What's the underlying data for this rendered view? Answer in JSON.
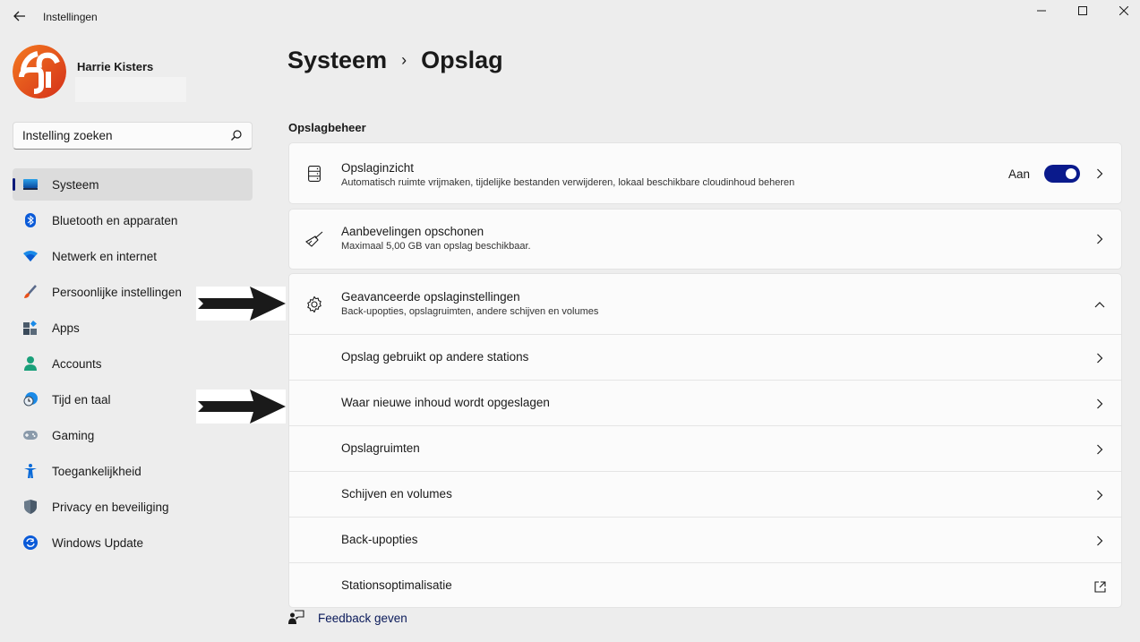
{
  "window": {
    "title": "Instellingen",
    "back_icon": "arrow-left-icon",
    "controls": [
      "minimize-icon",
      "maximize-icon",
      "close-icon"
    ]
  },
  "profile": {
    "name": "Harrie Kisters",
    "avatar_colors": [
      "#e84a1e",
      "#f47a20",
      "#d4301a"
    ]
  },
  "search": {
    "placeholder": "Instelling zoeken",
    "value": ""
  },
  "sidebar": {
    "items": [
      {
        "label": "Systeem",
        "icon": "monitor-icon",
        "active": true
      },
      {
        "label": "Bluetooth en apparaten",
        "icon": "bluetooth-icon",
        "active": false
      },
      {
        "label": "Netwerk en internet",
        "icon": "wifi-icon",
        "active": false
      },
      {
        "label": "Persoonlijke instellingen",
        "icon": "paintbrush-icon",
        "active": false
      },
      {
        "label": "Apps",
        "icon": "apps-icon",
        "active": false
      },
      {
        "label": "Accounts",
        "icon": "person-icon",
        "active": false
      },
      {
        "label": "Tijd en taal",
        "icon": "clock-globe-icon",
        "active": false
      },
      {
        "label": "Gaming",
        "icon": "gamepad-icon",
        "active": false
      },
      {
        "label": "Toegankelijkheid",
        "icon": "accessibility-icon",
        "active": false
      },
      {
        "label": "Privacy en beveiliging",
        "icon": "shield-icon",
        "active": false
      },
      {
        "label": "Windows Update",
        "icon": "update-icon",
        "active": false
      }
    ]
  },
  "breadcrumb": {
    "parent": "Systeem",
    "separator": "›",
    "current": "Opslag"
  },
  "section": {
    "title": "Opslagbeheer"
  },
  "cards": {
    "storage_sense": {
      "title": "Opslaginzicht",
      "subtitle": "Automatisch ruimte vrijmaken, tijdelijke bestanden verwijderen, lokaal beschikbare cloudinhoud beheren",
      "toggle_label": "Aan",
      "toggle_on": true,
      "icon": "storage-drive-icon"
    },
    "cleanup": {
      "title": "Aanbevelingen opschonen",
      "subtitle": "Maximaal 5,00 GB van opslag beschikbaar.",
      "icon": "broom-icon"
    },
    "advanced": {
      "title": "Geavanceerde opslaginstellingen",
      "subtitle": "Back-upopties, opslagruimten, andere schijven en volumes",
      "icon": "gear-icon",
      "expanded": true,
      "items": [
        {
          "label": "Opslag gebruikt op andere stations",
          "trailing": "chevron-right-icon"
        },
        {
          "label": "Waar nieuwe inhoud wordt opgeslagen",
          "trailing": "chevron-right-icon"
        },
        {
          "label": "Opslagruimten",
          "trailing": "chevron-right-icon"
        },
        {
          "label": "Schijven en volumes",
          "trailing": "chevron-right-icon"
        },
        {
          "label": "Back-upopties",
          "trailing": "chevron-right-icon"
        },
        {
          "label": "Stationsoptimalisatie",
          "trailing": "external-link-icon"
        }
      ]
    }
  },
  "feedback": {
    "label": "Feedback geven",
    "icon": "feedback-icon"
  },
  "colors": {
    "accent": "#0a1a8c",
    "background": "#ededed",
    "card": "#fbfbfb"
  }
}
